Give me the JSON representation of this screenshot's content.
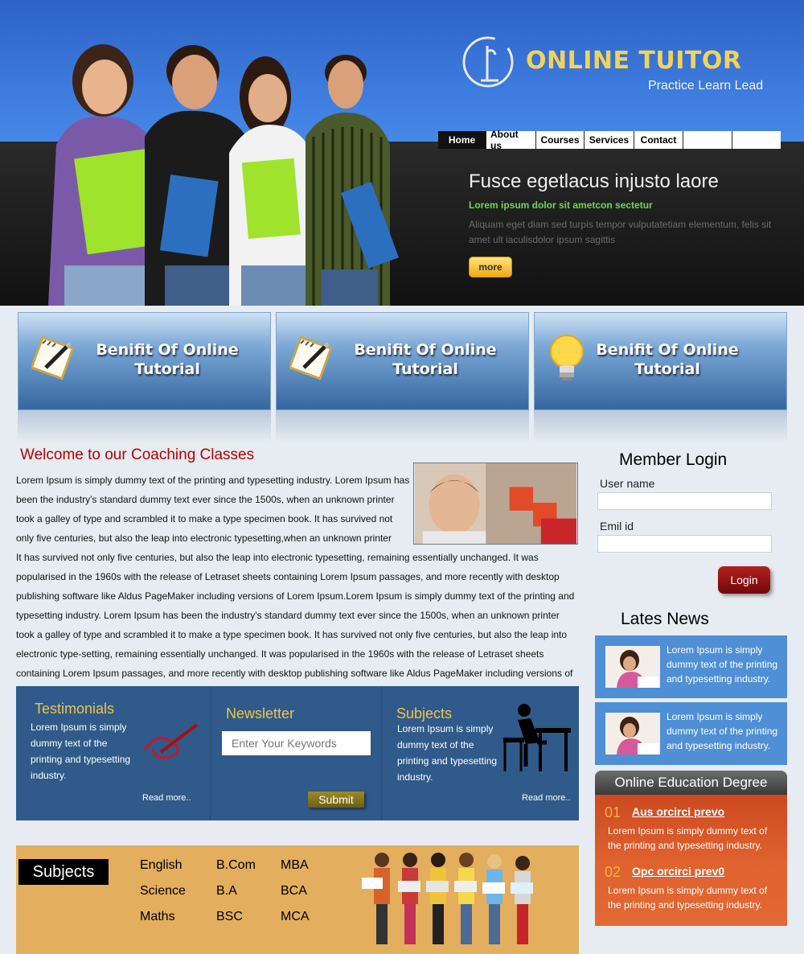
{
  "brand": {
    "name": "ONLINE TUITOR",
    "tagline": "Practice Learn Lead"
  },
  "nav": {
    "items": [
      "Home",
      "About us",
      "Courses",
      "Services",
      "Contact",
      "",
      ""
    ],
    "active": "Home"
  },
  "hero": {
    "title": "Fusce egetlacus injusto laore",
    "subtitle": "Lorem ipsum dolor sit ametcon sectetur",
    "description": "Aliquam eget diam sed turpis tempor vulputatetiam elementum, felis sit amet ult iaculisdolor ipsum sagittis",
    "more_label": "more"
  },
  "benefits": [
    {
      "title": "Benifit Of Online Tutorial",
      "icon": "notepad-pen-icon"
    },
    {
      "title": "Benifit Of Online Tutorial",
      "icon": "notepad-pen-icon"
    },
    {
      "title": "Benifit Of Online Tutorial",
      "icon": "lightbulb-icon"
    }
  ],
  "welcome": {
    "title": "Welcome to our Coaching Classes",
    "para_narrow": "Lorem Ipsum is simply dummy text of the printing and typesetting industry. Lorem Ipsum has been the industry's standard dummy text ever since the 1500s, when an unknown printer took a galley of type and scrambled it to make a type specimen book. It has survived not only five centuries, but also the leap into electronic typesetting,when an unknown printer",
    "para_wide": "It has survived not only five centuries, but also the leap into electronic typesetting, remaining essentially unchanged. It was popularised in the 1960s with the release of Letraset sheets containing Lorem Ipsum passages, and more recently with desktop publishing software like Aldus PageMaker including versions of Lorem Ipsum.Lorem Ipsum is simply dummy text of the printing and typesetting industry. Lorem Ipsum has been the industry's standard dummy text ever since the 1500s, when an unknown printer took a galley of type and scrambled it to make a type specimen book. It has survived not only five centuries, but also the leap into electronic type-setting, remaining essentially unchanged. It was popularised in the 1960s with the release of Letraset sheets containing Lorem Ipsum passages, and more recently with desktop publishing software like Aldus PageMaker including versions of Lorem Ipsum."
  },
  "testimonials": {
    "title": "Testimonials",
    "text": "Lorem Ipsum is simply dummy text of the printing and typesetting industry.",
    "read_more": "Read more.."
  },
  "newsletter": {
    "title": "Newsletter",
    "placeholder": "Enter Your Keywords",
    "submit": "Submit"
  },
  "subjects_panel": {
    "title": "Subjects",
    "text": "Lorem Ipsum is simply dummy text of the printing and typesetting industry.",
    "read_more": "Read more.."
  },
  "subjects_strip": {
    "label": "Subjects",
    "col1": [
      "English",
      "Science",
      "Maths"
    ],
    "col2": [
      "B.Com",
      "B.A",
      "BSC"
    ],
    "col3": [
      "MBA",
      "BCA",
      "MCA"
    ]
  },
  "login": {
    "title": "Member  Login",
    "user_label": "User name",
    "email_label": "Emil id",
    "button": "Login"
  },
  "news": {
    "title": "Lates News",
    "items": [
      "Lorem Ipsum is simply dummy text of the printing and typesetting industry.",
      "Lorem Ipsum is simply dummy text of the printing and typesetting industry."
    ]
  },
  "degree": {
    "title": "Online Education Degree",
    "items": [
      {
        "num": "01",
        "link": "Aus orcirci prevo",
        "text": "Lorem Ipsum is simply dummy text of the printing and typesetting industry."
      },
      {
        "num": "02",
        "link": "Opc orcirci prev0",
        "text": "Lorem Ipsum is simply dummy text of the printing and typesetting industry."
      }
    ]
  },
  "colors": {
    "accent_blue": "#2f5a8a",
    "title_red": "#bb0000",
    "gold": "#f2c34a",
    "orange": "#e0622f"
  }
}
